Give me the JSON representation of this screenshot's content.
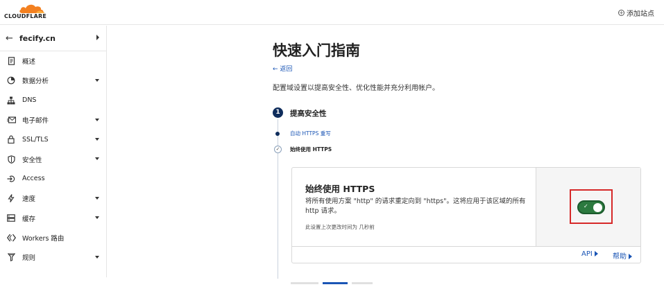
{
  "header": {
    "logo_text": "CLOUDFLARE",
    "add_site_label": "添加站点",
    "brand_color": "#f38020"
  },
  "sidebar": {
    "domain": "fecify.cn",
    "items": [
      {
        "label": "概述",
        "icon": "document-icon",
        "has_caret": false
      },
      {
        "label": "数据分析",
        "icon": "clock-chart-icon",
        "has_caret": true
      },
      {
        "label": "DNS",
        "icon": "network-icon",
        "has_caret": false
      },
      {
        "label": "电子邮件",
        "icon": "mail-icon",
        "has_caret": true
      },
      {
        "label": "SSL/TLS",
        "icon": "lock-icon",
        "has_caret": true
      },
      {
        "label": "安全性",
        "icon": "shield-icon",
        "has_caret": true
      },
      {
        "label": "Access",
        "icon": "access-icon",
        "has_caret": false
      },
      {
        "label": "速度",
        "icon": "lightning-icon",
        "has_caret": true
      },
      {
        "label": "缓存",
        "icon": "server-icon",
        "has_caret": true
      },
      {
        "label": "Workers 路由",
        "icon": "workers-icon",
        "has_caret": false
      },
      {
        "label": "规则",
        "icon": "funnel-icon",
        "has_caret": true
      }
    ]
  },
  "main": {
    "title": "快速入门指南",
    "back_label": "返回",
    "description": "配置域设置以提高安全性、优化性能并充分利用帐户。",
    "step": {
      "number": "1",
      "title": "提高安全性",
      "substeps": [
        "自动 HTTPS 重写",
        "始终使用 HTTPS"
      ]
    },
    "card": {
      "title": "始终使用 HTTPS",
      "description": "将所有使用方案 \"http\" 的请求重定向到 \"https\"。这将应用于该区域的所有 http 请求。",
      "note": "此设置上次更改时间为 几秒前",
      "toggle_on": true,
      "toggle_check": "✓",
      "api_label": "API",
      "help_label": "帮助"
    }
  },
  "colors": {
    "accent": "#1a55b5",
    "toggle_on": "#2c7a3f",
    "highlight": "#d62828",
    "step": "#0f2d5c"
  }
}
